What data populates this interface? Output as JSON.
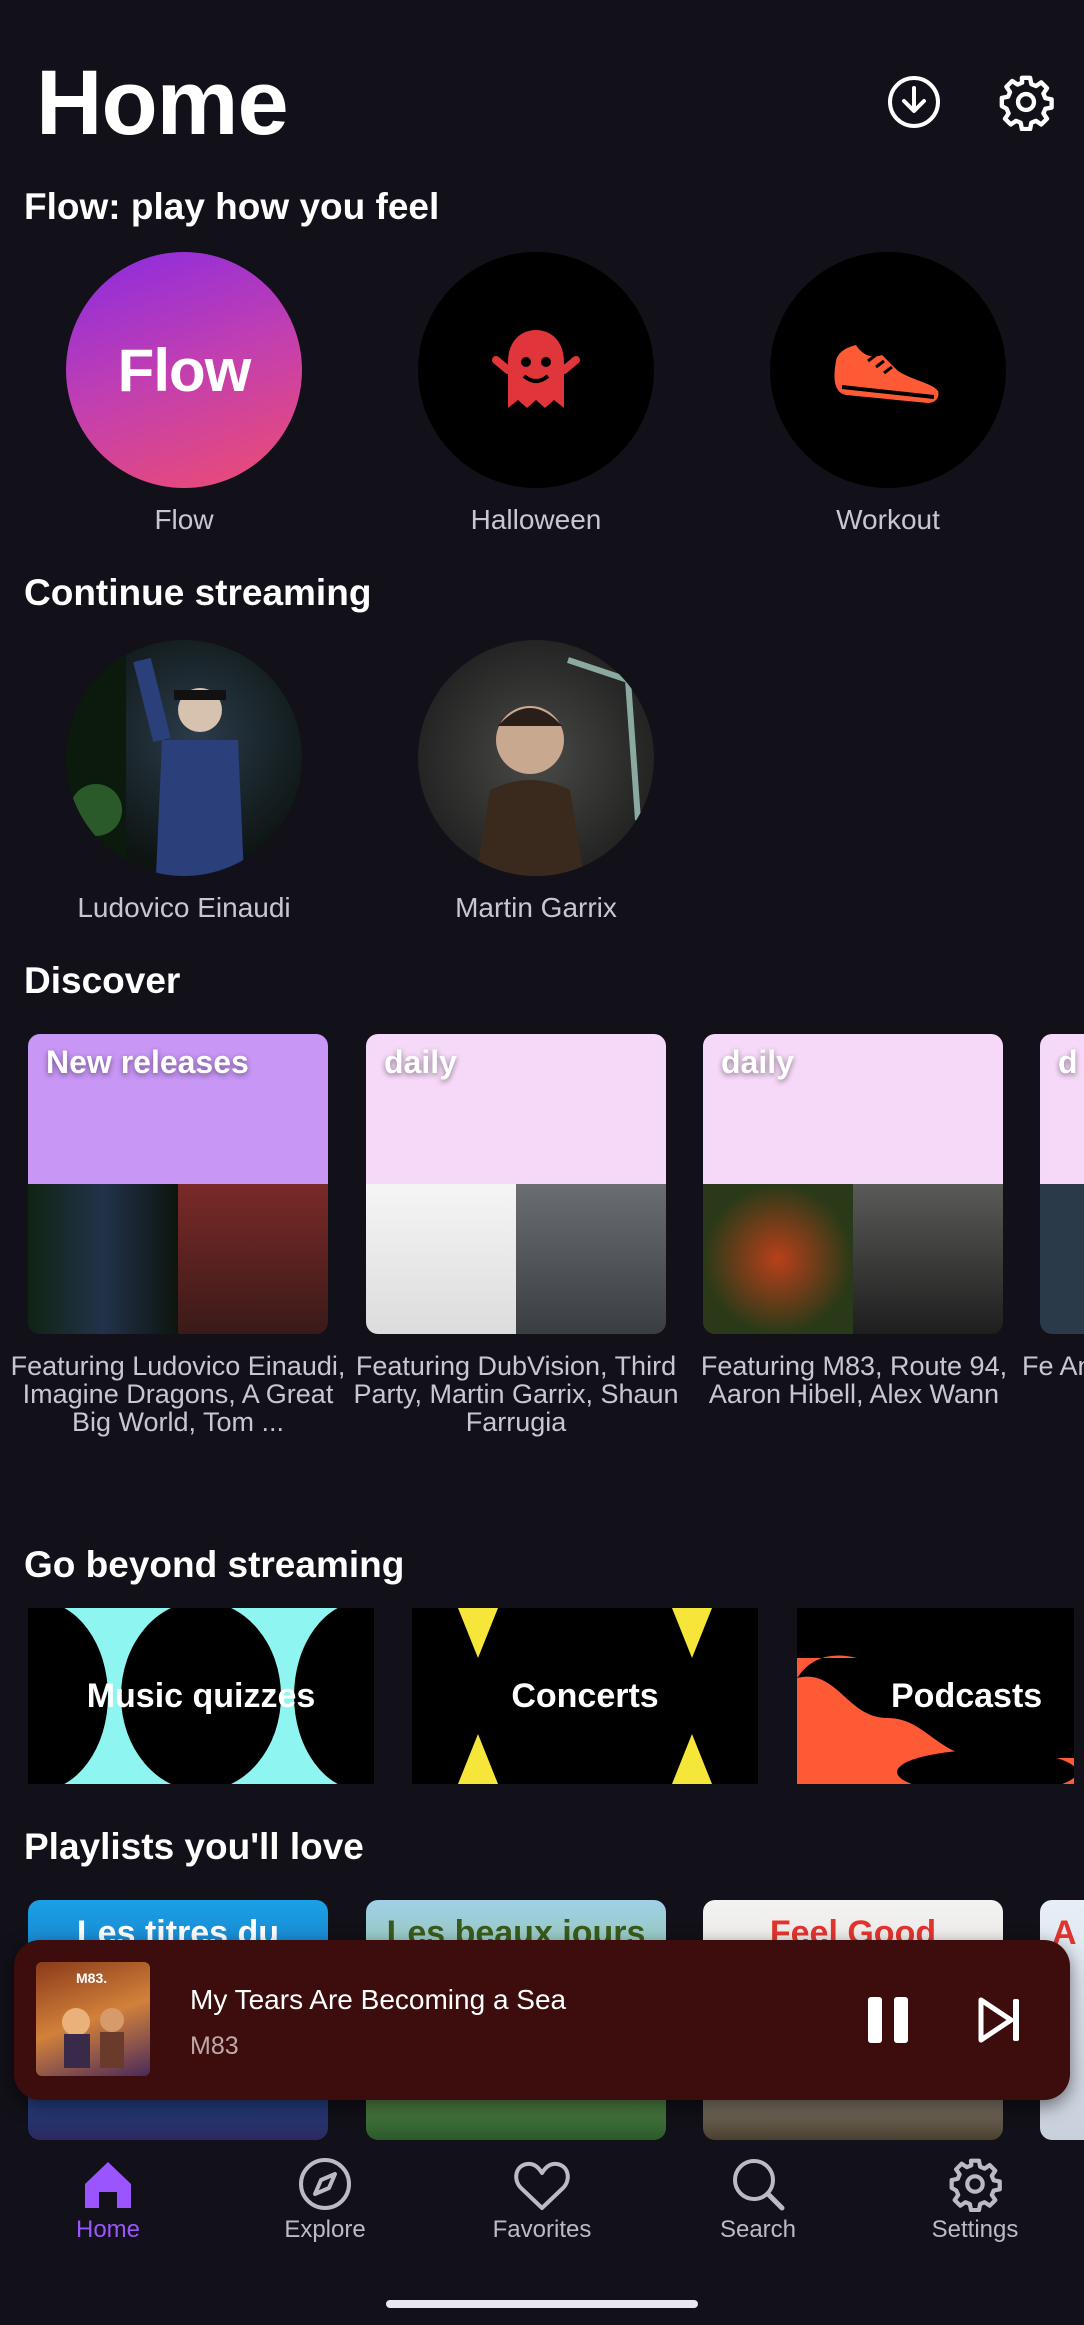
{
  "header": {
    "title": "Home",
    "download_icon": "download-icon",
    "settings_icon": "gear-icon"
  },
  "flow": {
    "title": "Flow: play how you feel",
    "items": [
      {
        "label": "Flow",
        "badge": "Flow",
        "icon": "flow-gradient"
      },
      {
        "label": "Halloween",
        "icon": "ghost-icon"
      },
      {
        "label": "Workout",
        "icon": "sneaker-icon"
      }
    ]
  },
  "continue": {
    "title": "Continue streaming",
    "items": [
      {
        "label": "Ludovico Einaudi"
      },
      {
        "label": "Martin Garrix"
      }
    ]
  },
  "discover": {
    "title": "Discover",
    "cards": [
      {
        "tag": "New releases",
        "desc": "Featuring Ludovico Einaudi, Imagine Dragons, A Great Big World, Tom ..."
      },
      {
        "tag": "daily",
        "desc": "Featuring DubVision, Third Party, Martin Garrix, Shaun Farrugia"
      },
      {
        "tag": "daily",
        "desc": "Featuring M83, Route 94, Aaron Hibell, Alex Wann"
      },
      {
        "tag": "d",
        "desc": "Fe Ann"
      }
    ]
  },
  "beyond": {
    "title": "Go beyond streaming",
    "items": [
      {
        "label": "Music quizzes"
      },
      {
        "label": "Concerts"
      },
      {
        "label": "Podcasts"
      }
    ]
  },
  "playlists": {
    "title": "Playlists you'll love",
    "items": [
      {
        "title": "Les titres du"
      },
      {
        "title": "Les beaux jours"
      },
      {
        "title": "Feel Good"
      },
      {
        "title": "A"
      }
    ]
  },
  "player": {
    "title": "My Tears Are Becoming a Sea",
    "artist": "M83",
    "art_text": "M83.",
    "pause_icon": "pause-icon",
    "next_icon": "skip-next-icon"
  },
  "nav": {
    "items": [
      {
        "label": "Home",
        "icon": "home-icon",
        "active": true
      },
      {
        "label": "Explore",
        "icon": "compass-icon"
      },
      {
        "label": "Favorites",
        "icon": "heart-icon"
      },
      {
        "label": "Search",
        "icon": "search-icon"
      },
      {
        "label": "Settings",
        "icon": "gear-icon"
      }
    ]
  },
  "colors": {
    "background": "#121018",
    "accent": "#9b55ff",
    "player_bg": "#3d0d0d"
  }
}
